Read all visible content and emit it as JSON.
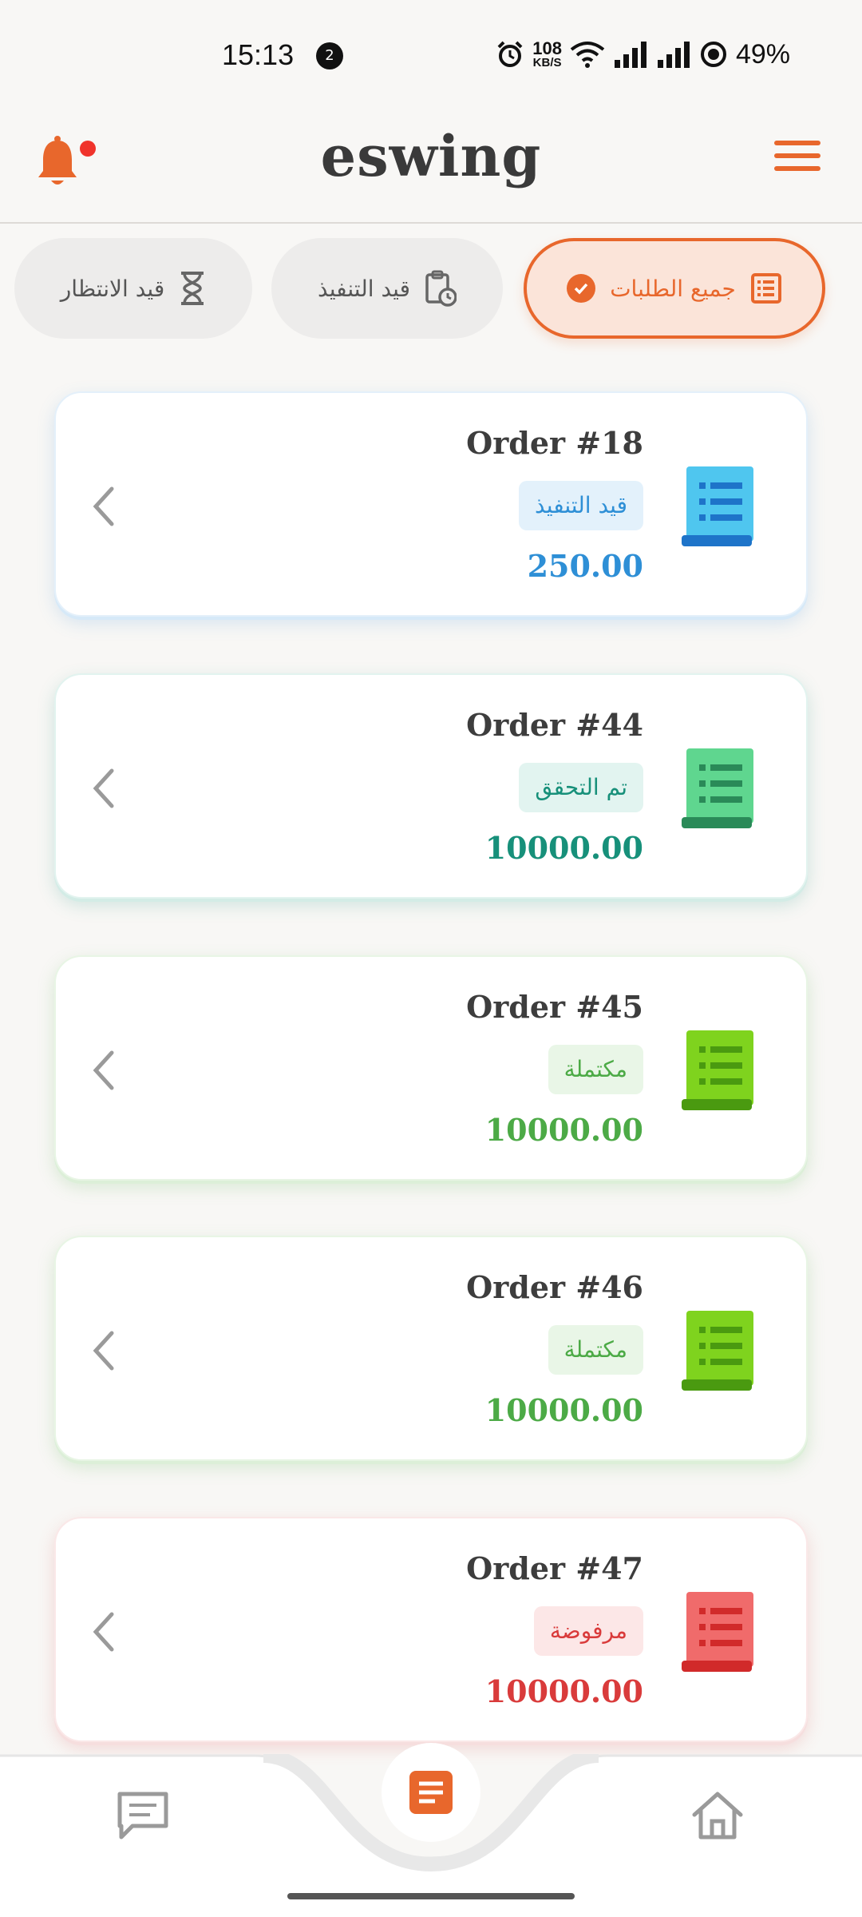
{
  "status_bar": {
    "time": "15:13",
    "notification_count": "2",
    "network_speed_value": "108",
    "network_speed_unit": "KB/S",
    "battery": "49%"
  },
  "header": {
    "brand": "eswing",
    "notification_dot": true,
    "accent_color": "#e8672c"
  },
  "filters": {
    "all": "جميع الطلبات",
    "in_progress": "قيد التنفيذ",
    "pending": "قيد الانتظار",
    "selected": "all"
  },
  "orders": [
    {
      "title": "Order #18",
      "status": "قيد التنفيذ",
      "amount": "250.00",
      "color": "#2e8fd6",
      "badge_bg": "#e3f1fb",
      "icon": "receipt-icon-blue"
    },
    {
      "title": "Order #44",
      "status": "تم التحقق",
      "amount": "10000.00",
      "color": "#17907a",
      "badge_bg": "#e2f4f0",
      "icon": "receipt-icon-teal"
    },
    {
      "title": "Order #45",
      "status": "مكتملة",
      "amount": "10000.00",
      "color": "#4caa46",
      "badge_bg": "#e9f6e7",
      "icon": "receipt-icon-green"
    },
    {
      "title": "Order #46",
      "status": "مكتملة",
      "amount": "10000.00",
      "color": "#4caa46",
      "badge_bg": "#e9f6e7",
      "icon": "receipt-icon-green"
    },
    {
      "title": "Order #47",
      "status": "مرفوضة",
      "amount": "10000.00",
      "color": "#d93b3b",
      "badge_bg": "#fce7e7",
      "icon": "receipt-icon-red"
    }
  ],
  "bottom_nav": {
    "items": [
      "chat-icon",
      "orders-icon",
      "home-icon"
    ],
    "active": "orders-icon"
  }
}
